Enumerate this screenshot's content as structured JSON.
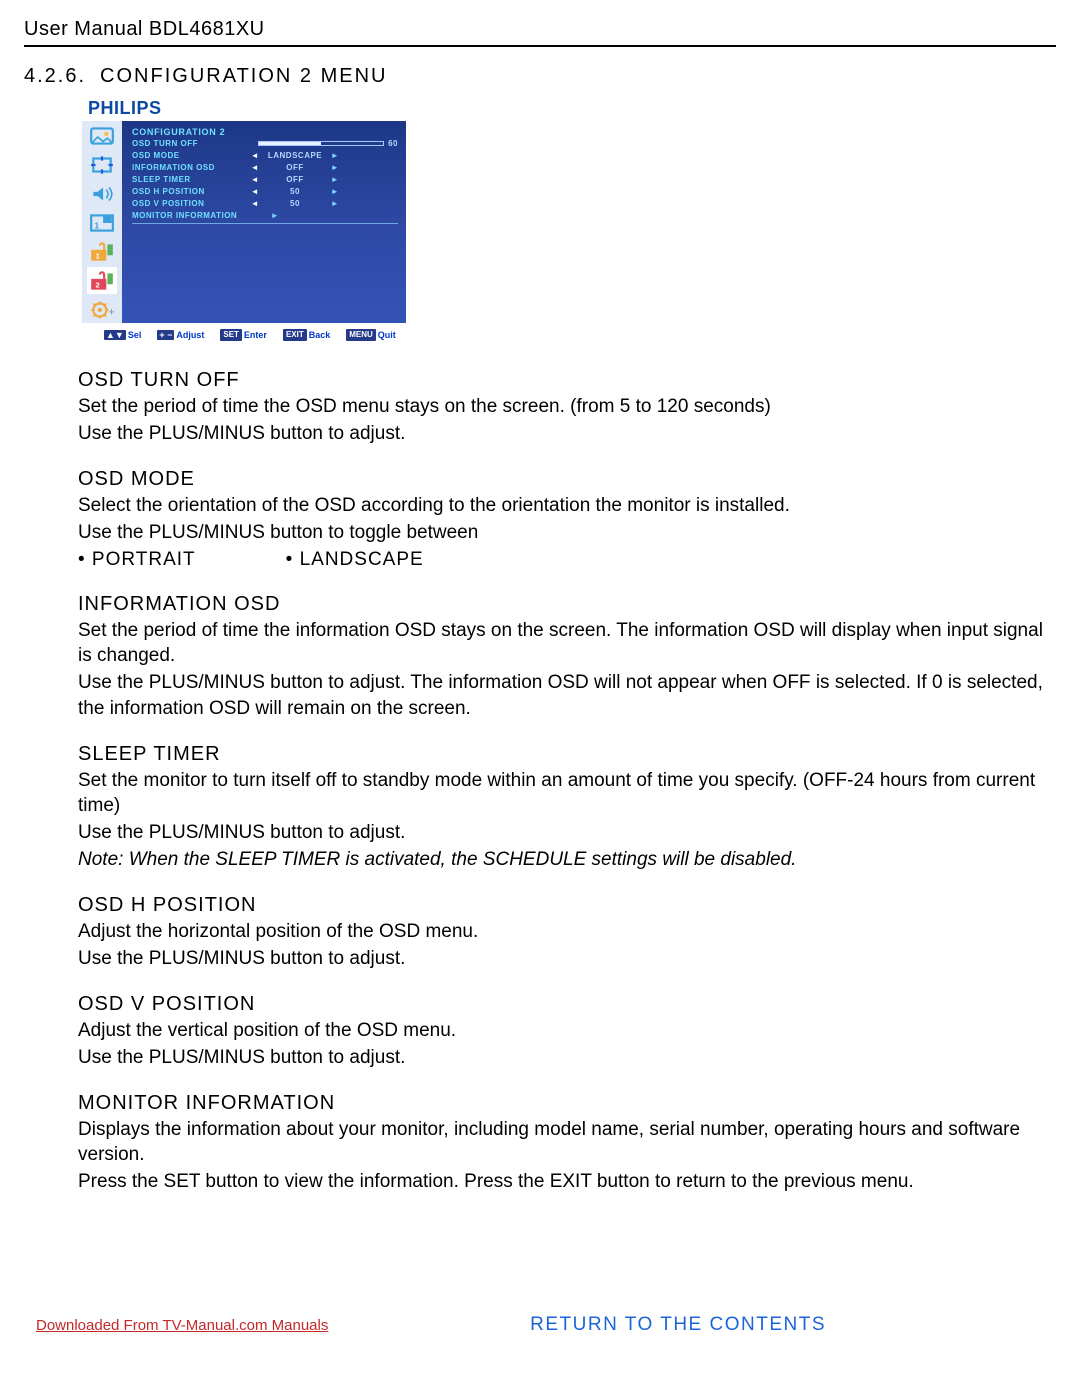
{
  "header": {
    "manual": "User Manual BDL4681XU"
  },
  "section": {
    "number": "4.2.6.",
    "title": "CONFIGURATION 2 MENU"
  },
  "osd": {
    "brand": "PHILIPS",
    "title": "CONFIGURATION 2",
    "items": [
      {
        "label": "OSD TURN OFF",
        "slider": true,
        "value_num": "60",
        "fill_pct": 50
      },
      {
        "label": "OSD MODE",
        "value": "LANDSCAPE"
      },
      {
        "label": "INFORMATION OSD",
        "value": "OFF"
      },
      {
        "label": "SLEEP TIMER",
        "value": "OFF"
      },
      {
        "label": "OSD H POSITION",
        "value": "50"
      },
      {
        "label": "OSD V POSITION",
        "value": "50"
      },
      {
        "label": "MONITOR INFORMATION",
        "only_right": true
      }
    ],
    "legend": {
      "sel": "Sel",
      "adjust": "Adjust",
      "set": "SET",
      "enter": "Enter",
      "exit": "EXIT",
      "back": "Back",
      "menu": "MENU",
      "quit": "Quit"
    }
  },
  "sections": [
    {
      "heading": "OSD TURN OFF",
      "paras": [
        "Set the period of time the OSD menu stays on the screen. (from 5 to 120 seconds)",
        "Use the PLUS/MINUS button to adjust."
      ]
    },
    {
      "heading": "OSD MODE",
      "paras": [
        "Select the orientation of the OSD according to the orientation the monitor is installed.",
        "Use the PLUS/MINUS button to toggle between"
      ],
      "bullets": [
        "• PORTRAIT",
        "• LANDSCAPE"
      ]
    },
    {
      "heading": "INFORMATION OSD",
      "paras": [
        "Set the period of time the information OSD stays on the screen. The information OSD will display when input signal is changed.",
        "Use the PLUS/MINUS button to adjust. The information OSD will not appear when OFF is selected. If 0 is selected, the information OSD will remain on the screen."
      ]
    },
    {
      "heading": "SLEEP TIMER",
      "paras": [
        "Set the monitor to turn itself off to standby mode within an amount of time you specify. (OFF-24 hours from current time)",
        "Use the PLUS/MINUS button to adjust."
      ],
      "note": "Note: When the SLEEP TIMER is activated, the SCHEDULE settings will be disabled."
    },
    {
      "heading": "OSD H POSITION",
      "paras": [
        "Adjust the horizontal position of the OSD menu.",
        "Use the PLUS/MINUS button to adjust."
      ]
    },
    {
      "heading": "OSD V POSITION",
      "paras": [
        "Adjust the vertical position of the OSD menu.",
        "Use the PLUS/MINUS button to adjust."
      ]
    },
    {
      "heading": "MONITOR INFORMATION",
      "paras": [
        "Displays the information about your monitor, including model name, serial number, operating hours and software version.",
        "Press the SET button to view the information. Press the EXIT button to return to the previous menu."
      ]
    }
  ],
  "footer": {
    "download": "Downloaded From TV-Manual.com Manuals",
    "return": "RETURN TO THE CONTENTS"
  }
}
